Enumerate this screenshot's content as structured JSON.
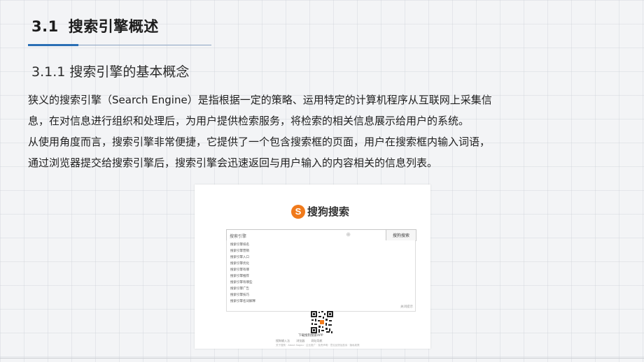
{
  "slide": {
    "section_number": "3.1",
    "section_title": "搜索引擎概述",
    "subsection_title": "3.1.1 搜索引擎的基本概念",
    "paragraph_1_line_1": "狭义的搜索引擎（Search Engine）是指根据一定的策略、运用特定的计算机程序从互联网上采集信",
    "paragraph_1_line_2": "息，在对信息进行组织和处理后，为用户提供检索服务，将检索的相关信息展示给用户的系统。",
    "paragraph_2_line_1": "从使用角度而言，搜索引擎非常便捷，它提供了一个包含搜索框的页面，用户在搜索框内输入词语，",
    "paragraph_2_line_2": "通过浏览器提交给搜索引擎后，搜索引擎会迅速返回与用户输入的内容相关的信息列表。"
  },
  "screenshot": {
    "logo_glyph": "S",
    "logo_text": "搜狗搜索",
    "search_query": "搜索引擎",
    "search_button": "搜狗搜索",
    "suggestions": [
      "搜索引擎排名",
      "搜索引擎营销",
      "搜索引擎入口",
      "搜索引擎优化",
      "搜索引擎有哪",
      "搜索引擎推荐",
      "搜索引擎有哪些",
      "搜索引擎广告",
      "搜索引擎技巧",
      "搜索引擎名词解释"
    ],
    "suggest_close": "关闭提示",
    "qr_caption": "下载搜狗搜索APP",
    "footer_links": [
      "搜狗输入法",
      "浏览器",
      "网址导航"
    ],
    "footer_copy": "关于搜狗 · About Sogou · 企业推广 · 免责声明 · 意见反馈及投诉 · 隐私政策"
  },
  "colors": {
    "accent_blue": "#2a6fb5",
    "sogou_orange": "#f07a1b"
  }
}
